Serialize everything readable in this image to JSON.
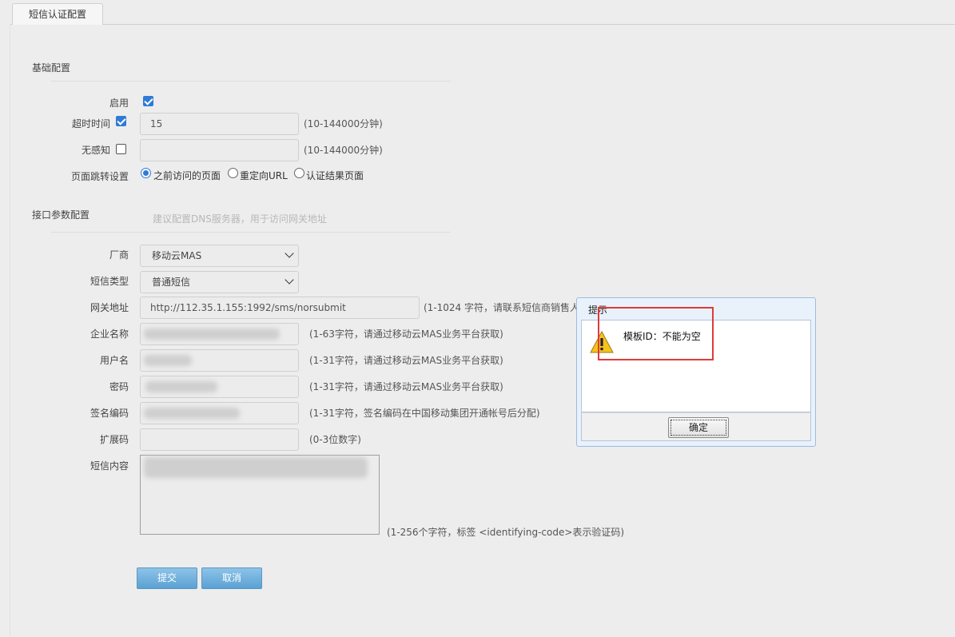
{
  "tab": {
    "label": "短信认证配置"
  },
  "basic": {
    "section_title": "基础配置",
    "enable_label": "启用",
    "timeout_label": "超时时间",
    "timeout_value": "15",
    "timeout_hint": "(10-144000分钟)",
    "unaware_label": "无感知",
    "unaware_value": "",
    "unaware_hint": "(10-144000分钟)",
    "redirect_label": "页面跳转设置",
    "redirect_options": [
      "之前访问的页面",
      "重定向URL",
      "认证结果页面"
    ]
  },
  "api": {
    "section_title": "接口参数配置",
    "section_hint": "建议配置DNS服务器，用于访问网关地址",
    "vendor_label": "厂商",
    "vendor_value": "移动云MAS",
    "sms_type_label": "短信类型",
    "sms_type_value": "普通短信",
    "gateway_label": "网关地址",
    "gateway_value": "http://112.35.1.155:1992/sms/norsubmit",
    "gateway_hint": "(1-1024 字符，请联系短信商销售人",
    "company_label": "企业名称",
    "company_hint": "(1-63字符，请通过移动云MAS业务平台获取)",
    "user_label": "用户名",
    "user_hint": "(1-31字符，请通过移动云MAS业务平台获取)",
    "password_label": "密码",
    "password_hint": "(1-31字符，请通过移动云MAS业务平台获取)",
    "sign_label": "签名编码",
    "sign_hint": "(1-31字符，签名编码在中国移动集团开通帐号后分配)",
    "ext_label": "扩展码",
    "ext_value": "",
    "ext_hint": "(0-3位数字)",
    "content_label": "短信内容",
    "content_hint": "(1-256个字符，标签 <identifying-code>表示验证码)"
  },
  "buttons": {
    "submit": "提交",
    "cancel": "取消"
  },
  "dialog": {
    "title": "提示",
    "message": "模板ID：不能为空",
    "ok": "确定"
  },
  "colors": {
    "accent": "#2f7bd6",
    "button": "#6aaedc",
    "highlight": "#e03a3a"
  }
}
